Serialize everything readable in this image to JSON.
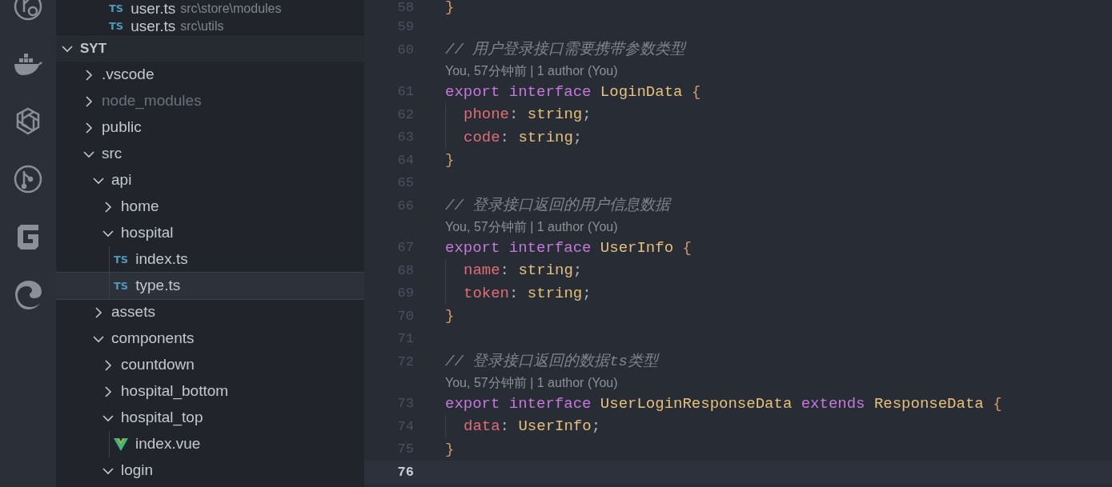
{
  "open_editors": [
    {
      "name": "user.ts",
      "path": "src\\store\\modules",
      "badge": "TS"
    },
    {
      "name": "user.ts",
      "path": "src\\utils",
      "badge": "TS"
    }
  ],
  "explorer": {
    "title": "SYT",
    "expanded": true,
    "children": [
      {
        "name": ".vscode",
        "kind": "folder",
        "expanded": false,
        "ignored": false,
        "selected": false
      },
      {
        "name": "node_modules",
        "kind": "folder",
        "expanded": false,
        "ignored": true,
        "selected": false
      },
      {
        "name": "public",
        "kind": "folder",
        "expanded": false,
        "ignored": false,
        "selected": false
      },
      {
        "name": "src",
        "kind": "folder",
        "expanded": true,
        "ignored": false,
        "selected": false,
        "children": [
          {
            "name": "api",
            "kind": "folder",
            "expanded": true,
            "ignored": false,
            "selected": false,
            "children": [
              {
                "name": "home",
                "kind": "folder",
                "expanded": false,
                "ignored": false,
                "selected": false
              },
              {
                "name": "hospital",
                "kind": "folder",
                "expanded": true,
                "ignored": false,
                "selected": false,
                "children": [
                  {
                    "name": "index.ts",
                    "kind": "file",
                    "badge": "TS",
                    "selected": false
                  },
                  {
                    "name": "type.ts",
                    "kind": "file",
                    "badge": "TS",
                    "selected": true
                  }
                ]
              }
            ]
          },
          {
            "name": "assets",
            "kind": "folder",
            "expanded": false,
            "ignored": false,
            "selected": false
          },
          {
            "name": "components",
            "kind": "folder",
            "expanded": true,
            "ignored": false,
            "selected": false,
            "children": [
              {
                "name": "countdown",
                "kind": "folder",
                "expanded": false,
                "ignored": false,
                "selected": false
              },
              {
                "name": "hospital_bottom",
                "kind": "folder",
                "expanded": false,
                "ignored": false,
                "selected": false
              },
              {
                "name": "hospital_top",
                "kind": "folder",
                "expanded": true,
                "ignored": false,
                "selected": false,
                "children": [
                  {
                    "name": "index.vue",
                    "kind": "file",
                    "selected": false
                  }
                ]
              },
              {
                "name": "login",
                "kind": "folder",
                "expanded": true,
                "ignored": false,
                "selected": false
              }
            ]
          }
        ]
      }
    ]
  },
  "editor": {
    "lines": [
      {
        "kind": "code",
        "number": "58",
        "current": false,
        "indent": false,
        "tokens": [
          {
            "kind": "brace",
            "text": "}"
          }
        ]
      },
      {
        "kind": "code",
        "number": "59",
        "current": false
      },
      {
        "kind": "code",
        "number": "60",
        "current": false,
        "indent": false,
        "tokens": [
          {
            "kind": "comment",
            "text": "// 用户登录接口需要携带参数类型"
          }
        ]
      },
      {
        "kind": "lens",
        "text": "You, 57分钟前 | 1 author (You)"
      },
      {
        "kind": "code",
        "number": "61",
        "current": false,
        "indent": false,
        "tokens": [
          {
            "kind": "keyword",
            "text": "export interface "
          },
          {
            "kind": "type",
            "text": "LoginData "
          },
          {
            "kind": "brace",
            "text": "{"
          }
        ]
      },
      {
        "kind": "code",
        "number": "62",
        "current": false,
        "indent": true,
        "tokens": [
          {
            "kind": "prop",
            "text": "phone"
          },
          {
            "kind": "punct",
            "text": ": "
          },
          {
            "kind": "type",
            "text": "string"
          },
          {
            "kind": "punct",
            "text": ";"
          }
        ]
      },
      {
        "kind": "code",
        "number": "63",
        "current": false,
        "indent": true,
        "tokens": [
          {
            "kind": "prop",
            "text": "code"
          },
          {
            "kind": "punct",
            "text": ": "
          },
          {
            "kind": "type",
            "text": "string"
          },
          {
            "kind": "punct",
            "text": ";"
          }
        ]
      },
      {
        "kind": "code",
        "number": "64",
        "current": false,
        "indent": false,
        "tokens": [
          {
            "kind": "brace",
            "text": "}"
          }
        ]
      },
      {
        "kind": "code",
        "number": "65",
        "current": false
      },
      {
        "kind": "code",
        "number": "66",
        "current": false,
        "indent": false,
        "tokens": [
          {
            "kind": "comment",
            "text": "// 登录接口返回的用户信息数据"
          }
        ]
      },
      {
        "kind": "lens",
        "text": "You, 57分钟前 | 1 author (You)"
      },
      {
        "kind": "code",
        "number": "67",
        "current": false,
        "indent": false,
        "tokens": [
          {
            "kind": "keyword",
            "text": "export interface "
          },
          {
            "kind": "type",
            "text": "UserInfo "
          },
          {
            "kind": "brace",
            "text": "{"
          }
        ]
      },
      {
        "kind": "code",
        "number": "68",
        "current": false,
        "indent": true,
        "tokens": [
          {
            "kind": "prop",
            "text": "name"
          },
          {
            "kind": "punct",
            "text": ": "
          },
          {
            "kind": "type",
            "text": "string"
          },
          {
            "kind": "punct",
            "text": ";"
          }
        ]
      },
      {
        "kind": "code",
        "number": "69",
        "current": false,
        "indent": true,
        "tokens": [
          {
            "kind": "prop",
            "text": "token"
          },
          {
            "kind": "punct",
            "text": ": "
          },
          {
            "kind": "type",
            "text": "string"
          },
          {
            "kind": "punct",
            "text": ";"
          }
        ]
      },
      {
        "kind": "code",
        "number": "70",
        "current": false,
        "indent": false,
        "tokens": [
          {
            "kind": "brace",
            "text": "}"
          }
        ]
      },
      {
        "kind": "code",
        "number": "71",
        "current": false
      },
      {
        "kind": "code",
        "number": "72",
        "current": false,
        "indent": false,
        "tokens": [
          {
            "kind": "comment",
            "text": "// 登录接口返回的数据ts类型"
          }
        ]
      },
      {
        "kind": "lens",
        "text": "You, 57分钟前 | 1 author (You)"
      },
      {
        "kind": "code",
        "number": "73",
        "current": false,
        "indent": false,
        "tokens": [
          {
            "kind": "keyword",
            "text": "export interface "
          },
          {
            "kind": "type",
            "text": "UserLoginResponseData "
          },
          {
            "kind": "keyword",
            "text": "extends "
          },
          {
            "kind": "type",
            "text": "ResponseData "
          },
          {
            "kind": "brace",
            "text": "{"
          }
        ]
      },
      {
        "kind": "code",
        "number": "74",
        "current": false,
        "indent": true,
        "tokens": [
          {
            "kind": "prop",
            "text": "data"
          },
          {
            "kind": "punct",
            "text": ": "
          },
          {
            "kind": "type",
            "text": "UserInfo"
          },
          {
            "kind": "punct",
            "text": ";"
          }
        ]
      },
      {
        "kind": "code",
        "number": "75",
        "current": false,
        "indent": false,
        "tokens": [
          {
            "kind": "brace",
            "text": "}"
          }
        ]
      },
      {
        "kind": "code",
        "number": "76",
        "current": true
      }
    ]
  }
}
